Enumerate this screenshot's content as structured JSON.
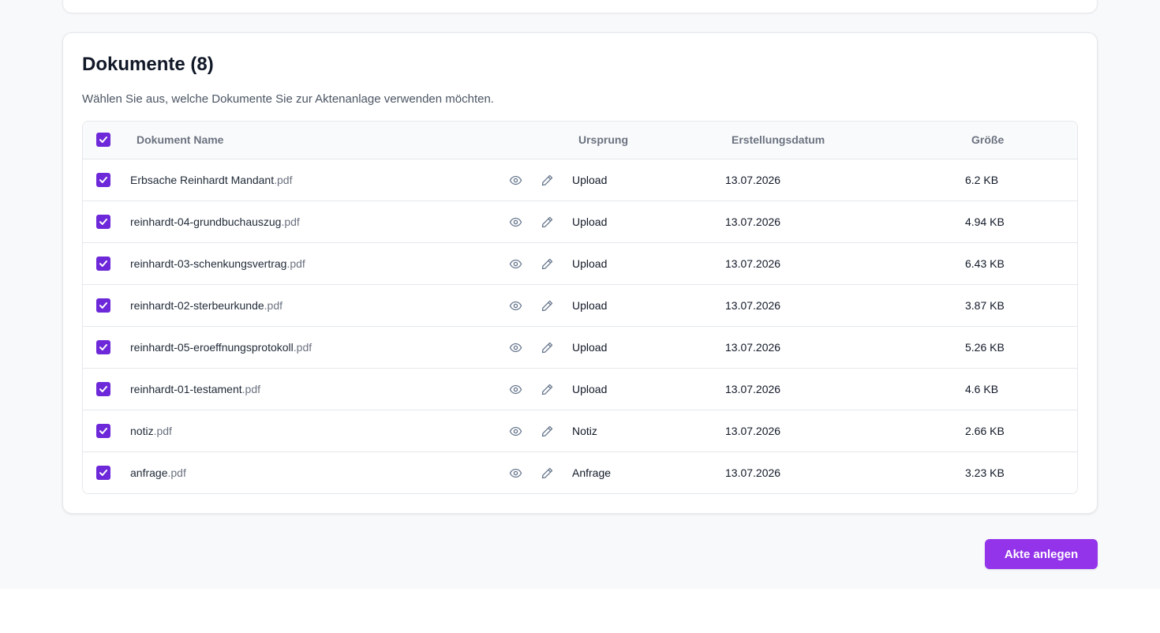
{
  "documents_section": {
    "title": "Dokumente (8)",
    "description": "Wählen Sie aus, welche Dokumente Sie zur Aktenanlage verwenden möchten.",
    "columns": {
      "name": "Dokument Name",
      "origin": "Ursprung",
      "created": "Erstellungsdatum",
      "size": "Größe"
    },
    "select_all_checked": true,
    "rows": [
      {
        "name": "Erbsache Reinhardt Mandant",
        "ext": ".pdf",
        "origin": "Upload",
        "date": "13.07.2026",
        "size": "6.2 KB",
        "checked": true
      },
      {
        "name": "reinhardt-04-grundbuchauszug",
        "ext": ".pdf",
        "origin": "Upload",
        "date": "13.07.2026",
        "size": "4.94 KB",
        "checked": true
      },
      {
        "name": "reinhardt-03-schenkungsvertrag",
        "ext": ".pdf",
        "origin": "Upload",
        "date": "13.07.2026",
        "size": "6.43 KB",
        "checked": true
      },
      {
        "name": "reinhardt-02-sterbeurkunde",
        "ext": ".pdf",
        "origin": "Upload",
        "date": "13.07.2026",
        "size": "3.87 KB",
        "checked": true
      },
      {
        "name": "reinhardt-05-eroeffnungsprotokoll",
        "ext": ".pdf",
        "origin": "Upload",
        "date": "13.07.2026",
        "size": "5.26 KB",
        "checked": true
      },
      {
        "name": "reinhardt-01-testament",
        "ext": ".pdf",
        "origin": "Upload",
        "date": "13.07.2026",
        "size": "4.6 KB",
        "checked": true
      },
      {
        "name": "notiz",
        "ext": ".pdf",
        "origin": "Notiz",
        "date": "13.07.2026",
        "size": "2.66 KB",
        "checked": true
      },
      {
        "name": "anfrage",
        "ext": ".pdf",
        "origin": "Anfrage",
        "date": "13.07.2026",
        "size": "3.23 KB",
        "checked": true
      }
    ]
  },
  "actions": {
    "create_file_label": "Akte anlegen"
  },
  "icons": {
    "checkbox": "checkmark-icon",
    "preview": "eye-icon",
    "edit": "pencil-icon"
  },
  "colors": {
    "accent": "#6d28d9",
    "button": "#9333ea",
    "background": "#f8f9fb"
  }
}
